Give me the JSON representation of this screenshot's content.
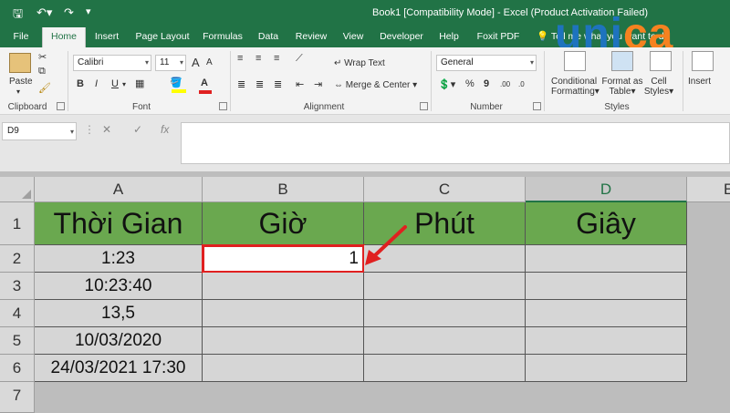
{
  "title_bar": {
    "doc_title": "Book1  [Compatibility Mode]  -  Excel (Product Activation Failed)",
    "save_icon": "save-icon",
    "undo_icon": "undo-icon",
    "redo_icon": "redo-icon"
  },
  "tabs": [
    {
      "label": "File"
    },
    {
      "label": "Home"
    },
    {
      "label": "Insert"
    },
    {
      "label": "Page Layout"
    },
    {
      "label": "Formulas"
    },
    {
      "label": "Data"
    },
    {
      "label": "Review"
    },
    {
      "label": "View"
    },
    {
      "label": "Developer"
    },
    {
      "label": "Help"
    },
    {
      "label": "Foxit PDF"
    }
  ],
  "tell_me": "Tell me what you want to do",
  "watermark": {
    "part1": "uni",
    "part2": "ca"
  },
  "ribbon": {
    "clipboard": {
      "paste_label": "Paste",
      "group_label": "Clipboard"
    },
    "font": {
      "font_name": "Calibri",
      "font_size": "11",
      "bold": "B",
      "italic": "I",
      "underline": "U",
      "group_label": "Font",
      "grow": "A",
      "shrink": "A"
    },
    "alignment": {
      "wrap_text": "Wrap Text",
      "merge_center": "Merge & Center",
      "group_label": "Alignment"
    },
    "number": {
      "format": "General",
      "percent": "%",
      "comma": "9",
      "group_label": "Number"
    },
    "styles": {
      "conditional_1": "Conditional",
      "conditional_2": "Formatting",
      "format_as_1": "Format as",
      "format_as_2": "Table",
      "cell_styles_1": "Cell",
      "cell_styles_2": "Styles",
      "group_label": "Styles"
    },
    "cells": {
      "insert": "Insert"
    }
  },
  "formula_bar": {
    "name_box": "D9",
    "cancel": "✕",
    "enter": "✓",
    "fx": "fx",
    "value": ""
  },
  "columns": [
    "A",
    "B",
    "C",
    "D",
    "E"
  ],
  "rows": [
    "1",
    "2",
    "3",
    "4",
    "5",
    "6",
    "7"
  ],
  "table": {
    "headers": [
      "Thời Gian",
      "Giờ",
      "Phút",
      "Giây"
    ],
    "col_a": [
      "1:23",
      "10:23:40",
      "13,5",
      "10/03/2020",
      "24/03/2021 17:30"
    ],
    "b2": "1"
  },
  "colors": {
    "excel_green": "#217346",
    "header_fill": "#6aa84f",
    "highlight_red": "#e02020",
    "logo_blue": "#1e73be",
    "logo_orange": "#f58220"
  }
}
